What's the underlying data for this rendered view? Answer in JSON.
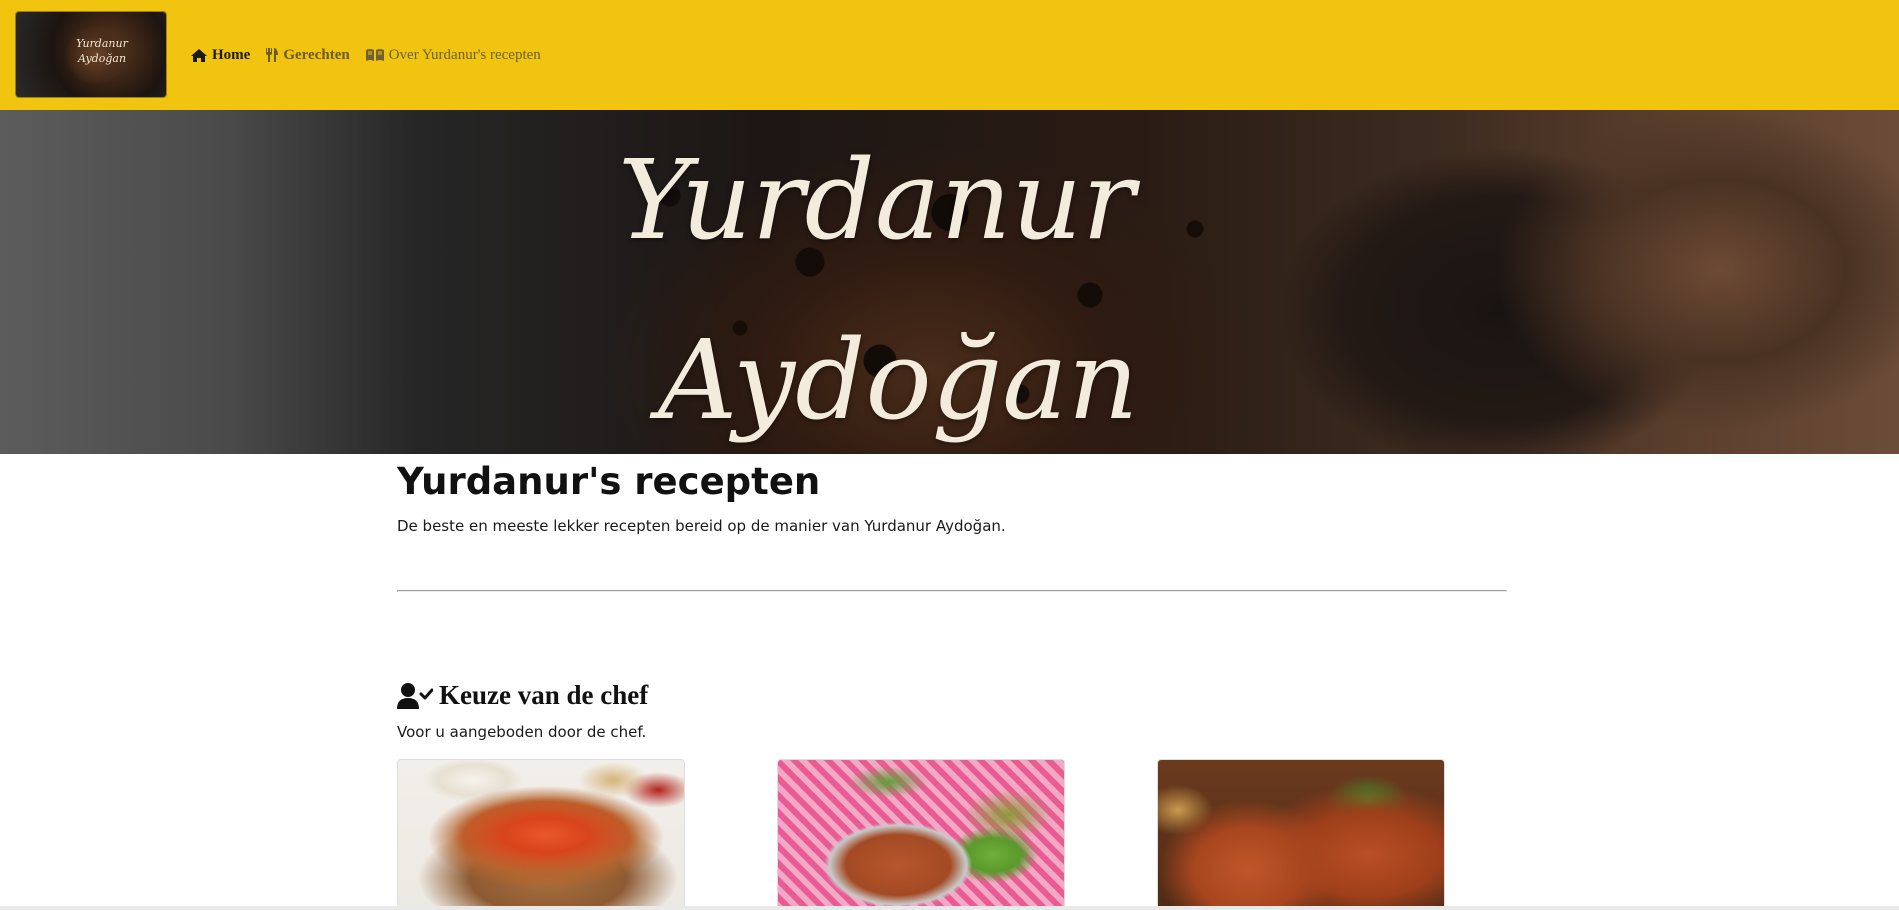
{
  "brand": {
    "logo_line1": "Yurdanur",
    "logo_line2": "Aydoğan"
  },
  "nav": {
    "items": [
      {
        "label": "Home",
        "icon": "home-icon",
        "active": true
      },
      {
        "label": "Gerechten",
        "icon": "utensils-icon",
        "active": false
      },
      {
        "label": "Over Yurdanur's recepten",
        "icon": "book-open-icon",
        "active": false
      }
    ]
  },
  "hero": {
    "line1": "Yurdanur",
    "line2": "Aydoğan"
  },
  "main": {
    "title": "Yurdanur's recepten",
    "subtitle": "De beste en meeste lekker recepten bereid op de manier van Yurdanur Aydoğan."
  },
  "chef_section": {
    "title": "Keuze van de chef",
    "subtitle": "Voor u aangeboden door de chef.",
    "icon": "user-check-icon"
  },
  "colors": {
    "navbar": "#f1c40f",
    "divider": "#555555"
  }
}
